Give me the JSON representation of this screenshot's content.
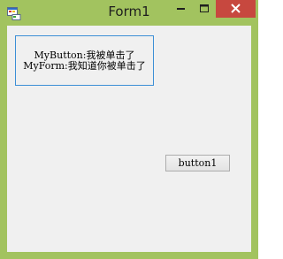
{
  "window": {
    "title": "Form1",
    "frame_color": "#a2c35f",
    "close_color": "#c7483f"
  },
  "titlebar_icons": {
    "app": "app-icon",
    "minimize": "minimize-icon",
    "maximize": "maximize-icon",
    "close": "close-icon"
  },
  "mybutton": {
    "line1": "MyButton:我被单击了",
    "line2": "MyForm:我知道你被单击了",
    "border_color": "#3c8fd6"
  },
  "button1": {
    "label": "button1"
  }
}
